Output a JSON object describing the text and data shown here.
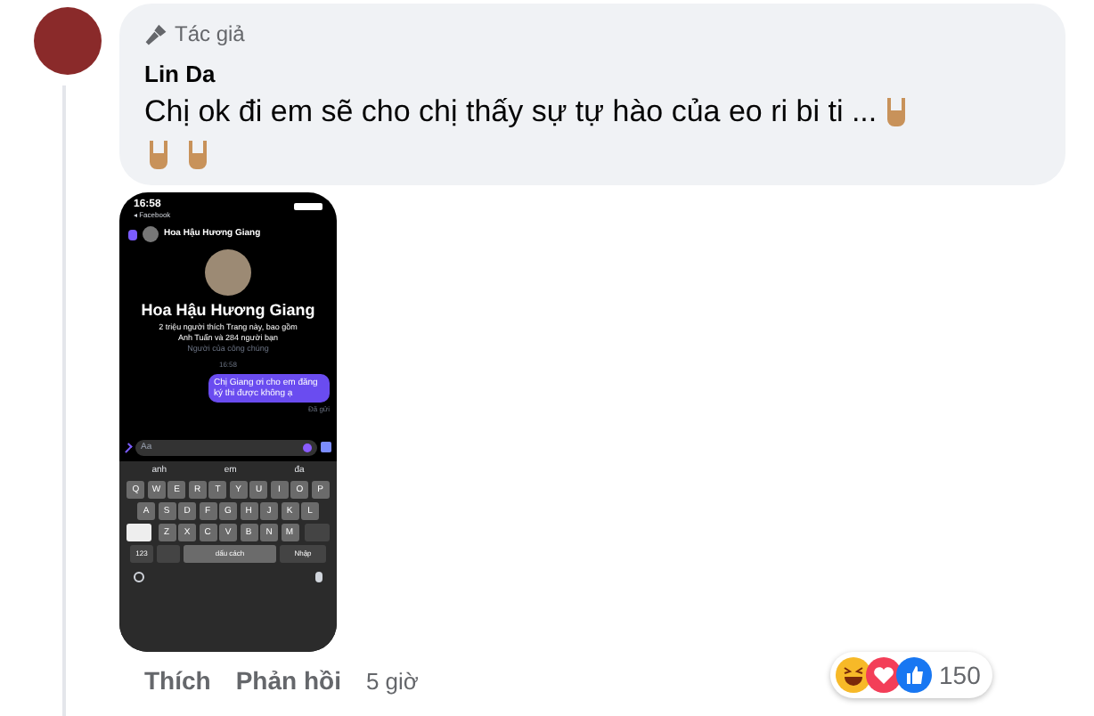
{
  "comment": {
    "badge": "Tác giả",
    "author": "Lin Da",
    "text": "Chị ok đi em sẽ cho chị thấy sự tự hào của eo ri bi ti ...",
    "attachment": {
      "status_time": "16:58",
      "status_source": "◂ Facebook",
      "header_name": "Hoa Hậu Hương Giang",
      "profile_name": "Hoa Hậu Hương Giang",
      "profile_info": "2 triệu người thích Trang này, bao gồm Anh Tuấn và 284 người bạn",
      "profile_category": "Người của công chúng",
      "chat_time": "16:58",
      "message": "Chị Giang ơi cho em đăng ký thi được không ạ",
      "message_status": "Đã gửi",
      "input_placeholder": "Aa",
      "suggestions": [
        "anh",
        "em",
        "đa"
      ],
      "key_rows": [
        [
          "Q",
          "W",
          "E",
          "R",
          "T",
          "Y",
          "U",
          "I",
          "O",
          "P"
        ],
        [
          "A",
          "S",
          "D",
          "F",
          "G",
          "H",
          "J",
          "K",
          "L"
        ],
        [
          "Z",
          "X",
          "C",
          "V",
          "B",
          "N",
          "M"
        ]
      ],
      "numbers_key": "123",
      "space_key": "dấu cách",
      "return_key": "Nhập"
    },
    "actions": [
      {
        "label": "Thích"
      },
      {
        "label": "Phản hồi"
      }
    ],
    "time": "5 giờ",
    "reaction_count": "150"
  }
}
